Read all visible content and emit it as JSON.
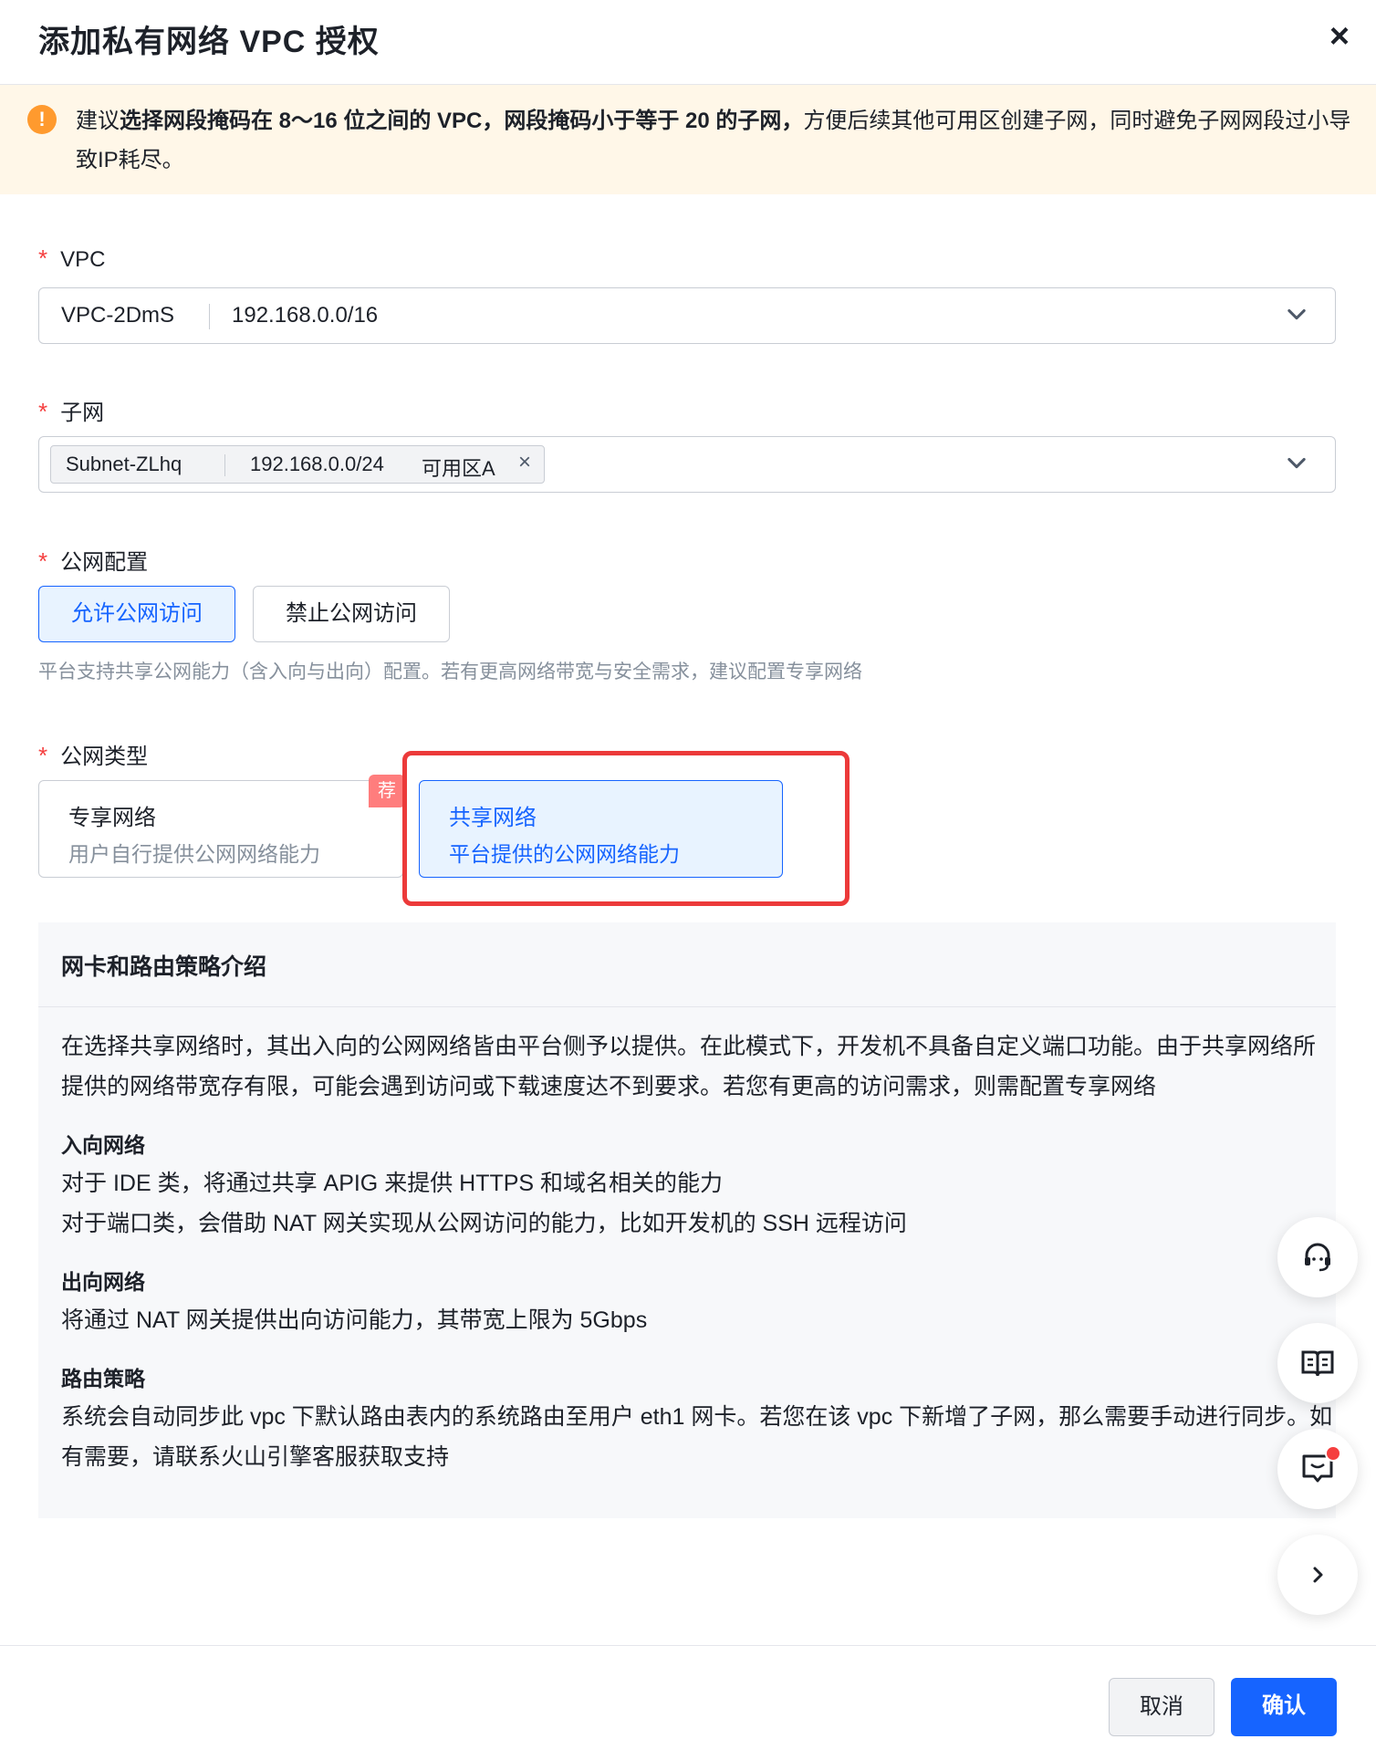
{
  "dialog": {
    "title": "添加私有网络 VPC 授权",
    "close_label": "×"
  },
  "alert": {
    "icon": "!",
    "prefix": "建议",
    "bold1": "选择网段掩码在 8～16 位之间的 VPC，网段掩码小于等于 20 的子网，",
    "rest": "方便后续其他可用区创建子网，同时避免子网网段过小导致IP耗尽。"
  },
  "form": {
    "required_mark": "*",
    "vpc": {
      "label": "VPC",
      "name": "VPC-2DmS",
      "cidr": "192.168.0.0/16"
    },
    "subnet": {
      "label": "子网",
      "tag_name": "Subnet-ZLhq",
      "tag_cidr": "192.168.0.0/24",
      "tag_zone": "可用区A",
      "tag_remove": "×"
    },
    "public_config": {
      "label": "公网配置",
      "options": [
        "允许公网访问",
        "禁止公网访问"
      ],
      "selected": "允许公网访问",
      "hint": "平台支持共享公网能力（含入向与出向）配置。若有更高网络带宽与安全需求，建议配置专享网络"
    },
    "public_type": {
      "label": "公网类型",
      "badge": "荐",
      "cards": [
        {
          "title": "专享网络",
          "desc": "用户自行提供公网网络能力"
        },
        {
          "title": "共享网络",
          "desc": "平台提供的公网网络能力"
        }
      ],
      "selected": "共享网络"
    }
  },
  "info": {
    "title": "网卡和路由策略介绍",
    "intro": "在选择共享网络时，其出入向的公网网络皆由平台侧予以提供。在此模式下，开发机不具备自定义端口功能。由于共享网络所提供的网络带宽存有限，可能会遇到访问或下载速度达不到要求。若您有更高的访问需求，则需配置专享网络",
    "inbound_title": "入向网络",
    "inbound_line1": "对于 IDE 类，将通过共享 APIG 来提供 HTTPS 和域名相关的能力",
    "inbound_line2": "对于端口类，会借助 NAT 网关实现从公网访问的能力，比如开发机的 SSH 远程访问",
    "outbound_title": "出向网络",
    "outbound_line1": "将通过 NAT 网关提供出向访问能力，其带宽上限为 5Gbps",
    "route_title": "路由策略",
    "route_text": "系统会自动同步此 vpc 下默认路由表内的系统路由至用户 eth1 网卡。若您在该 vpc 下新增了子网，那么需要手动进行同步。如有需要，请联系火山引擎客服获取支持"
  },
  "footer": {
    "cancel": "取消",
    "confirm": "确认"
  },
  "colors": {
    "primary": "#1664ff",
    "primary_light": "#e8f3ff",
    "warning_bg": "#fff7e8",
    "warning_icon": "#ff9a2e",
    "required": "#f53f3f",
    "highlight_border": "#ec3a3a"
  },
  "icons": {
    "alert": "warning-circle-icon",
    "chevron": "chevron-down-icon",
    "support": "headset-icon",
    "docs": "book-icon",
    "feedback": "message-icon",
    "expand": "chevron-right-icon"
  }
}
